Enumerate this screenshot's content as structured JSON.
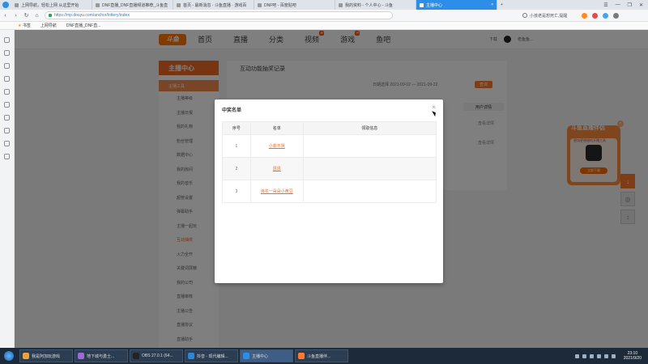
{
  "browser": {
    "tabs": [
      {
        "label": "上网导航，轻松上网 从这里开始",
        "active": false
      },
      {
        "label": "DNF直播_DNF直播频道推荐_斗鱼直",
        "active": false
      },
      {
        "label": "首页 - 最新消息 · 斗鱼直播 · 游戏百",
        "active": false
      },
      {
        "label": "DNF吧 - 百度贴吧",
        "active": false
      },
      {
        "label": "我的资料 - 个人中心 - 斗鱼",
        "active": false
      },
      {
        "label": "主播中心",
        "active": true
      }
    ],
    "new_tab": "+",
    "window_controls": [
      "☰",
      "—",
      "❐",
      "✕"
    ],
    "url": "https://mp.douyu.com/anchor/lottery/index",
    "search_suggest": "小孩老是想死亡,提醒",
    "bookmarks": [
      "书签",
      "上网导航",
      "DNF直播_DNF直..."
    ]
  },
  "site": {
    "logo": "斗鱼",
    "nav": [
      {
        "label": "首页",
        "badge": ""
      },
      {
        "label": "直播",
        "badge": ""
      },
      {
        "label": "分类",
        "badge": ""
      },
      {
        "label": "视频",
        "badge": "新"
      },
      {
        "label": "游戏",
        "badge": "热"
      },
      {
        "label": "鱼吧",
        "badge": ""
      }
    ],
    "header_right": {
      "phone": "下载",
      "user": "老鱼鱼..."
    }
  },
  "sidebar": {
    "title": "主播中心",
    "section": "主播工具",
    "items": [
      "主播等级",
      "主播日报",
      "我的礼物",
      "粉丝管理",
      "数据中心",
      "我的房间",
      "我的音乐",
      "超管设置",
      "弹幕助手",
      "主播一起玩",
      "互动抽奖",
      "火力全开",
      "关键词屏蔽",
      "我的公司",
      "直播审核",
      "主播公告",
      "直播协议",
      "直播助手"
    ],
    "active_item": "互动抽奖"
  },
  "content": {
    "title": "互动功能抽奖记录",
    "date_range": "日期选择  2021-09-02 — 2021-09-22",
    "query_button": "查询",
    "column_head": "用户详情",
    "view_links": [
      "查看详情",
      "查看详情"
    ]
  },
  "promo": {
    "title": "斗鱼直播伴侣",
    "desc": "更快更便捷的开播工具",
    "button": "立即下载",
    "close": "×"
  },
  "float_tools": [
    "↓",
    "◎",
    "↕"
  ],
  "modal": {
    "title": "中奖名单",
    "close": "×",
    "headers": [
      "序号",
      "名单",
      "领取信息"
    ],
    "rows": [
      {
        "index": "1",
        "name": "小菲不哭",
        "info": ""
      },
      {
        "index": "2",
        "name": "恩恩",
        "info": ""
      },
      {
        "index": "3",
        "name": "浪花一朵朵小黄豆",
        "info": ""
      }
    ]
  },
  "taskbar": {
    "tasks": [
      {
        "label": "我是阿加玩游戏",
        "color": "#e8a33b"
      },
      {
        "label": "地下城与勇士...",
        "color": "#9b6bd3"
      },
      {
        "label": "OBS 27.0.1 (64...",
        "color": "#222222"
      },
      {
        "label": "抖音 - 现代编辑...",
        "color": "#2f86d8"
      },
      {
        "label": "主播中心",
        "color": "#2c8ee8"
      },
      {
        "label": "斗鱼直播伴...",
        "color": "#ff7a2f"
      }
    ],
    "clock_time": "23:10",
    "clock_date": "2021/9/20"
  }
}
